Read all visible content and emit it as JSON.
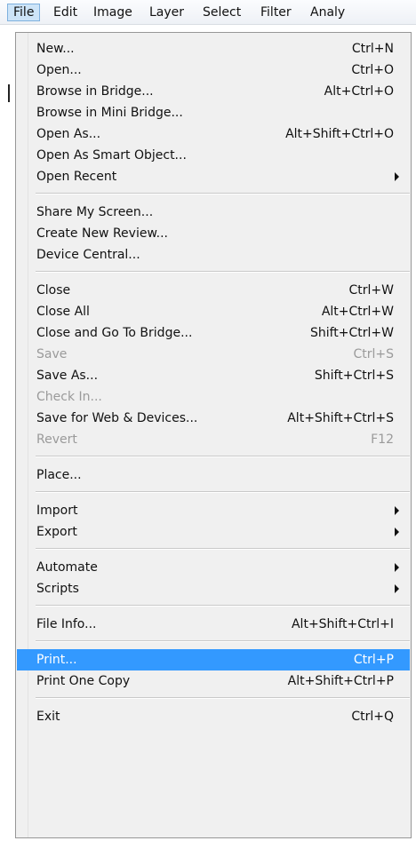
{
  "menubar": {
    "items": [
      "File",
      "Edit",
      "Image",
      "Layer",
      "Select",
      "Filter",
      "Analy"
    ]
  },
  "menu": {
    "items": {
      "new": {
        "label": "New...",
        "shortcut": "Ctrl+N"
      },
      "open": {
        "label": "Open...",
        "shortcut": "Ctrl+O"
      },
      "browse_bridge": {
        "label": "Browse in Bridge...",
        "shortcut": "Alt+Ctrl+O"
      },
      "browse_mini": {
        "label": "Browse in Mini Bridge...",
        "shortcut": ""
      },
      "open_as": {
        "label": "Open As...",
        "shortcut": "Alt+Shift+Ctrl+O"
      },
      "open_smart": {
        "label": "Open As Smart Object...",
        "shortcut": ""
      },
      "open_recent": {
        "label": "Open Recent",
        "shortcut": ""
      },
      "share_screen": {
        "label": "Share My Screen...",
        "shortcut": ""
      },
      "new_review": {
        "label": "Create New Review...",
        "shortcut": ""
      },
      "device_central": {
        "label": "Device Central...",
        "shortcut": ""
      },
      "close": {
        "label": "Close",
        "shortcut": "Ctrl+W"
      },
      "close_all": {
        "label": "Close All",
        "shortcut": "Alt+Ctrl+W"
      },
      "close_bridge": {
        "label": "Close and Go To Bridge...",
        "shortcut": "Shift+Ctrl+W"
      },
      "save": {
        "label": "Save",
        "shortcut": "Ctrl+S"
      },
      "save_as": {
        "label": "Save As...",
        "shortcut": "Shift+Ctrl+S"
      },
      "check_in": {
        "label": "Check In...",
        "shortcut": ""
      },
      "save_web": {
        "label": "Save for Web & Devices...",
        "shortcut": "Alt+Shift+Ctrl+S"
      },
      "revert": {
        "label": "Revert",
        "shortcut": "F12"
      },
      "place": {
        "label": "Place...",
        "shortcut": ""
      },
      "import": {
        "label": "Import",
        "shortcut": ""
      },
      "export": {
        "label": "Export",
        "shortcut": ""
      },
      "automate": {
        "label": "Automate",
        "shortcut": ""
      },
      "scripts": {
        "label": "Scripts",
        "shortcut": ""
      },
      "file_info": {
        "label": "File Info...",
        "shortcut": "Alt+Shift+Ctrl+I"
      },
      "print": {
        "label": "Print...",
        "shortcut": "Ctrl+P"
      },
      "print_one": {
        "label": "Print One Copy",
        "shortcut": "Alt+Shift+Ctrl+P"
      },
      "exit": {
        "label": "Exit",
        "shortcut": "Ctrl+Q"
      }
    },
    "disabled": [
      "save",
      "check_in",
      "revert"
    ],
    "highlighted": "print",
    "highlight_color": "#3399ff"
  }
}
